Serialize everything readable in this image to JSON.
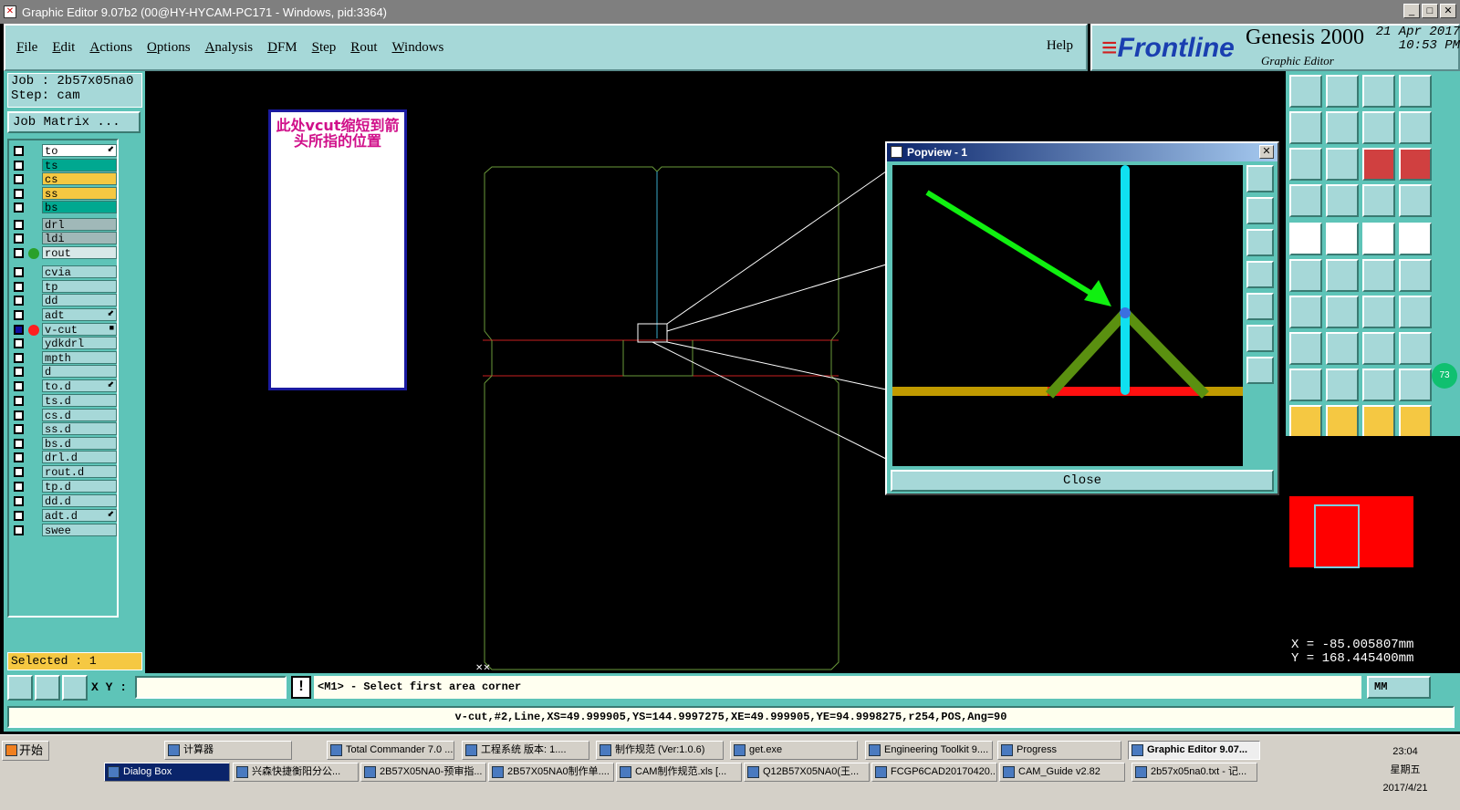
{
  "window": {
    "title": "Graphic Editor 9.07b2 (00@HY-HYCAM-PC171 - Windows, pid:3364)"
  },
  "menu": {
    "items": [
      "File",
      "Edit",
      "Actions",
      "Options",
      "Analysis",
      "DFM",
      "Step",
      "Rout",
      "Windows"
    ],
    "help": "Help"
  },
  "brand": {
    "logo": "Frontline",
    "product": "Genesis 2000",
    "subtitle": "Graphic Editor",
    "date": "21 Apr 2017",
    "time": "10:53 PM"
  },
  "job": {
    "job_label": "Job : 2b57x05na0",
    "step_label": "Step: cam",
    "matrix_button": "Job Matrix ..."
  },
  "layers": [
    {
      "name": "to",
      "color": "#ffffff",
      "mark": "⬋"
    },
    {
      "name": "ts",
      "color": "#00a890",
      "mark": ""
    },
    {
      "name": "cs",
      "color": "#f5c842",
      "mark": ""
    },
    {
      "name": "ss",
      "color": "#f5c842",
      "mark": ""
    },
    {
      "name": "bs",
      "color": "#00a890",
      "mark": ""
    },
    {
      "name": "drl",
      "color": "#a0b8b8",
      "mark": ""
    },
    {
      "name": "ldi",
      "color": "#a0b8b8",
      "mark": ""
    },
    {
      "name": "rout",
      "color": "#d8e8e8",
      "mark": ""
    },
    {
      "name": "cvia",
      "color": "#a6d8d8",
      "mark": ""
    },
    {
      "name": "tp",
      "color": "#a6d8d8",
      "mark": ""
    },
    {
      "name": "dd",
      "color": "#a6d8d8",
      "mark": ""
    },
    {
      "name": "adt",
      "color": "#a6d8d8",
      "mark": "⬋"
    },
    {
      "name": "v-cut",
      "color": "#a6d8d8",
      "mark": "■"
    },
    {
      "name": "ydkdrl",
      "color": "#a6d8d8",
      "mark": ""
    },
    {
      "name": "mpth",
      "color": "#a6d8d8",
      "mark": ""
    },
    {
      "name": "d",
      "color": "#a6d8d8",
      "mark": ""
    },
    {
      "name": "to.d",
      "color": "#a6d8d8",
      "mark": "⬋"
    },
    {
      "name": "ts.d",
      "color": "#a6d8d8",
      "mark": ""
    },
    {
      "name": "cs.d",
      "color": "#a6d8d8",
      "mark": ""
    },
    {
      "name": "ss.d",
      "color": "#a6d8d8",
      "mark": ""
    },
    {
      "name": "bs.d",
      "color": "#a6d8d8",
      "mark": ""
    },
    {
      "name": "drl.d",
      "color": "#a6d8d8",
      "mark": ""
    },
    {
      "name": "rout.d",
      "color": "#a6d8d8",
      "mark": ""
    },
    {
      "name": "tp.d",
      "color": "#a6d8d8",
      "mark": ""
    },
    {
      "name": "dd.d",
      "color": "#a6d8d8",
      "mark": ""
    },
    {
      "name": "adt.d",
      "color": "#a6d8d8",
      "mark": "⬋"
    },
    {
      "name": "swee",
      "color": "#a6d8d8",
      "mark": ""
    }
  ],
  "selected": "Selected : 1",
  "note": "此处vcut缩短到箭头所指的位置",
  "popview": {
    "title": "Popview - 1",
    "close": "Close"
  },
  "coords": {
    "x": "X = -85.005807mm",
    "y": "Y = 168.445400mm"
  },
  "cmd": {
    "xy_label": "X Y :",
    "prompt": "<M1> - Select first area corner",
    "units": "MM"
  },
  "status": "v-cut,#2,Line,XS=49.999905,YS=144.9997275,XE=49.999905,YE=94.9998275,r254,POS,Ang=90",
  "minimap_badge": "73",
  "taskbar": {
    "start": "开始",
    "row1": [
      "计算器",
      "Total Commander 7.0 ...",
      "工程系统  版本: 1....",
      "制作规范 (Ver:1.0.6)",
      "get.exe",
      "Engineering Toolkit 9....",
      "Progress",
      "Graphic Editor 9.07..."
    ],
    "row2": [
      "Dialog Box",
      "兴森快捷衡阳分公...",
      "2B57X05NA0-预审指...",
      "2B57X05NA0制作单....",
      "CAM制作规范.xls [...",
      "Q12B57X05NA0(王...",
      "FCGP6CAD20170420...",
      "CAM_Guide v2.82",
      "2b57x05na0.txt - 记..."
    ],
    "clock_time": "23:04",
    "clock_day": "星期五",
    "clock_date": "2017/4/21"
  }
}
